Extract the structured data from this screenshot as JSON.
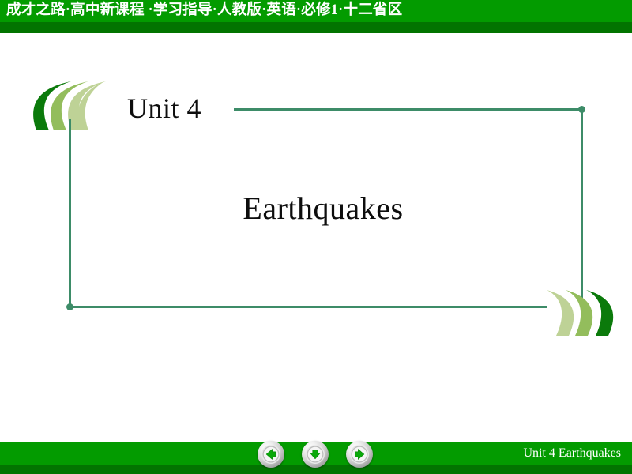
{
  "theme": {
    "header_green_bright": "#039b00",
    "header_green_dark": "#027400",
    "frame_line_color": "#3d8c68",
    "chevron_dark": "#0b7a0b",
    "chevron_mid": "#93bd5c",
    "chevron_light": "#bed296",
    "text_color": "#0d0d0d",
    "header_text_color": "#ffffff"
  },
  "header": {
    "title": "成才之路·高中新课程 ·学习指导·人教版·英语·必修1·十二省区"
  },
  "content": {
    "unit_label": "Unit 4",
    "title": "Earthquakes"
  },
  "footer": {
    "label": "Unit  4  Earthquakes",
    "nav": {
      "prev_label": "Previous slide",
      "down_label": "Next animation",
      "next_label": "Next slide"
    }
  },
  "decorations": {
    "left_chevrons_icon": "triple-crescent-left-icon",
    "right_chevrons_icon": "triple-crescent-right-icon"
  }
}
